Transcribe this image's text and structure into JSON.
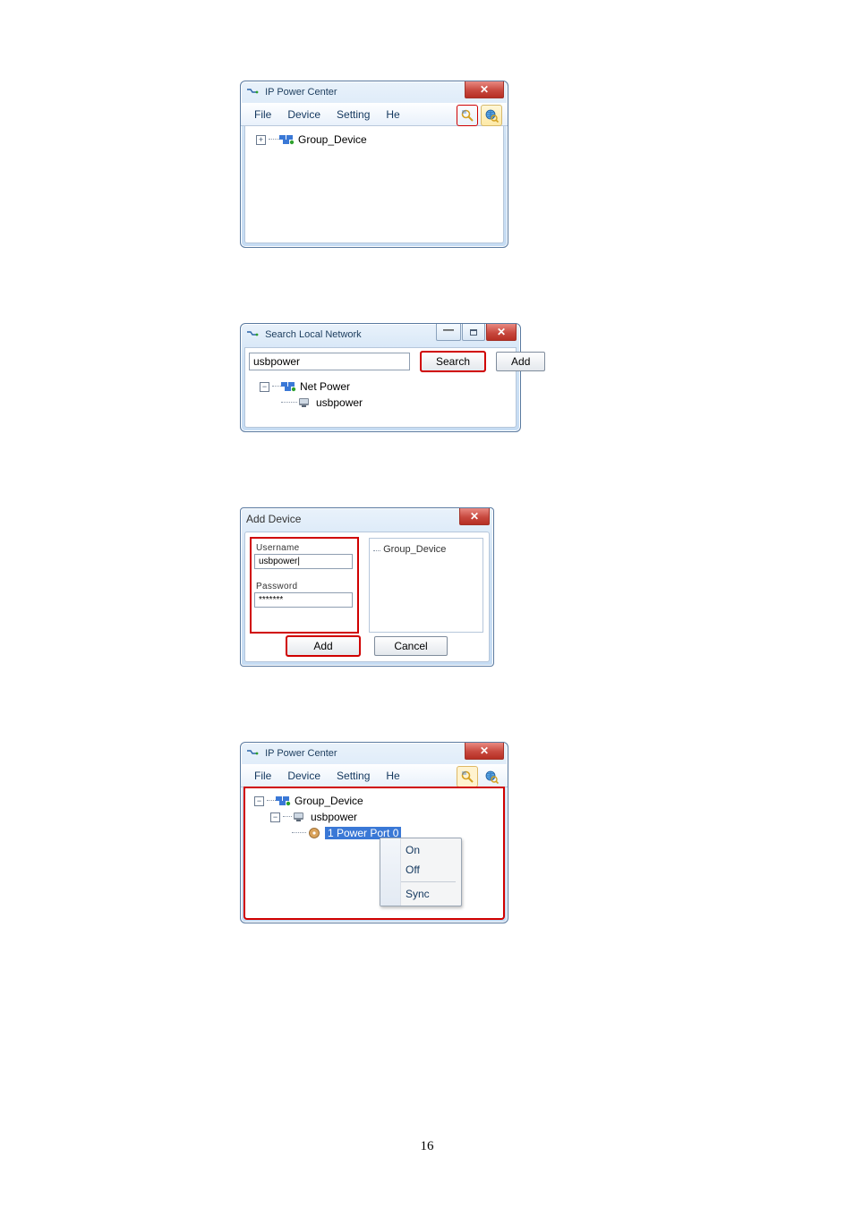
{
  "page_number": "16",
  "ipc_window_1": {
    "title": "IP Power Center",
    "menu": {
      "file": "File",
      "device": "Device",
      "setting": "Setting",
      "help_truncated": "He"
    },
    "tree": {
      "root": "Group_Device",
      "root_expander": "+"
    }
  },
  "search_window": {
    "title": "Search Local Network",
    "input_value": "usbpower",
    "buttons": {
      "search": "Search",
      "add": "Add"
    },
    "tree": {
      "root": "Net Power",
      "root_expander": "−",
      "child": "usbpower"
    }
  },
  "add_device_window": {
    "title": "Add Device",
    "labels": {
      "username": "Username",
      "password": "Password"
    },
    "values": {
      "username": "usbpower|",
      "password": "*******"
    },
    "right_tree_label": "Group_Device",
    "buttons": {
      "add": "Add",
      "cancel": "Cancel"
    }
  },
  "ipc_window_2": {
    "title": "IP Power Center",
    "menu": {
      "file": "File",
      "device": "Device",
      "setting": "Setting",
      "help_truncated": "He"
    },
    "tree": {
      "root": "Group_Device",
      "root_expander": "−",
      "child": "usbpower",
      "child_expander": "−",
      "leaf_selected": "1 Power Port 0"
    },
    "context_menu": {
      "on": "On",
      "off": "Off",
      "sync": "Sync"
    }
  }
}
